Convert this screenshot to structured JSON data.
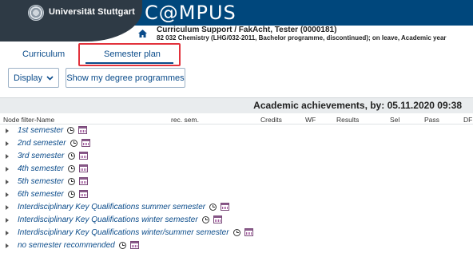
{
  "header": {
    "logo_text": "Universität Stuttgart",
    "app_title": "C@MPUS",
    "user_line": "Curriculum Support  / FakAcht, Tester (0000181)",
    "programme_line": "82 032 Chemistry (LHG/032-2011, Bachelor programme, discontinued); on leave, Academic year"
  },
  "tabs": {
    "curriculum": "Curriculum",
    "semester_plan": "Semester plan"
  },
  "buttons": {
    "display": "Display",
    "degree_programmes": "Show my degree programmes"
  },
  "achievements_title": "Academic achievements, by: 05.11.2020 09:38",
  "table": {
    "columns": {
      "node_filter": "Node filter-Name",
      "rec_sem": "rec. sem.",
      "credits": "Credits",
      "wf": "WF",
      "results": "Results",
      "sel": "Sel",
      "pass": "Pass",
      "df": "DF"
    },
    "rows": [
      "1st semester",
      "2nd semester",
      "3rd semester",
      "4th semester",
      "5th semester",
      "6th semester",
      "Interdisciplinary Key Qualifications summer semester",
      "Interdisciplinary Key Qualifications winter semester",
      "Interdisciplinary Key Qualifications winter/summer semester",
      "no semester recommended"
    ]
  },
  "colors": {
    "header_blue": "#00477c",
    "logo_dark": "#2e3a45",
    "link_blue": "#0a4b8a",
    "highlight_red": "#e2323c",
    "bar_gray": "#e9ecee"
  },
  "icons": {
    "home": "home-icon",
    "display_chevron": "chevron-down-icon",
    "row_caret": "caret-right-icon",
    "clock": "clock-icon",
    "calendar": "calendar-icon"
  }
}
